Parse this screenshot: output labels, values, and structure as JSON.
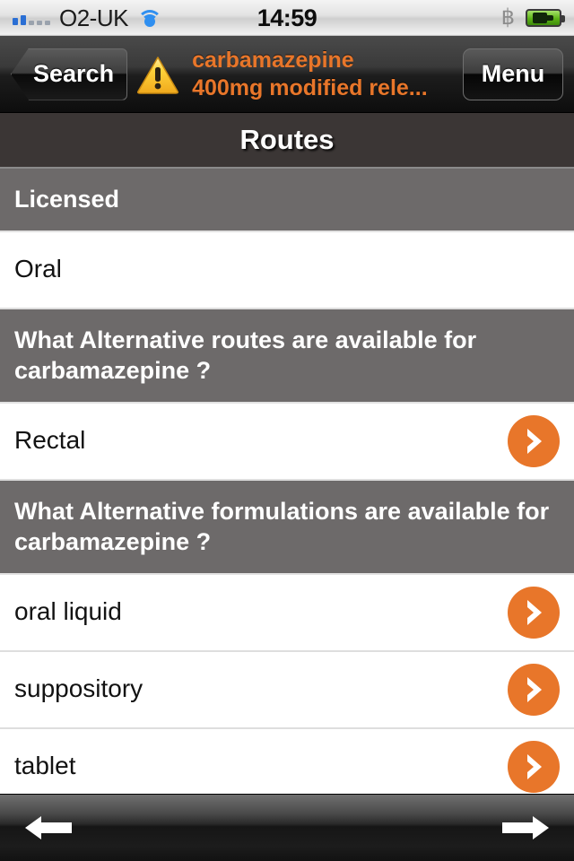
{
  "status_bar": {
    "carrier": "O2-UK",
    "time": "14:59",
    "signal_icon": "signal-bars-icon",
    "wifi_icon": "wifi-icon",
    "bluetooth_icon": "bluetooth-icon",
    "battery_icon": "battery-charging-icon"
  },
  "nav_bar": {
    "back_label": "Search",
    "menu_label": "Menu",
    "warning_icon": "warning-triangle-icon",
    "title_line1": "carbamazepine",
    "title_line2": "400mg modified rele...",
    "title_color": "#e8762a"
  },
  "page_title": "Routes",
  "accent_color": "#e8762a",
  "sections": [
    {
      "header": "Licensed",
      "rows": [
        {
          "label": "Oral",
          "has_chevron": false
        }
      ]
    },
    {
      "header": "What Alternative routes are available for carbamazepine ?",
      "rows": [
        {
          "label": "Rectal",
          "has_chevron": true
        }
      ]
    },
    {
      "header": "What Alternative formulations are available for carbamazepine ?",
      "rows": [
        {
          "label": "oral liquid",
          "has_chevron": true
        },
        {
          "label": "suppository",
          "has_chevron": true
        },
        {
          "label": "tablet",
          "has_chevron": true
        }
      ]
    }
  ],
  "toolbar": {
    "back_icon": "arrow-left-icon",
    "forward_icon": "arrow-right-icon"
  }
}
